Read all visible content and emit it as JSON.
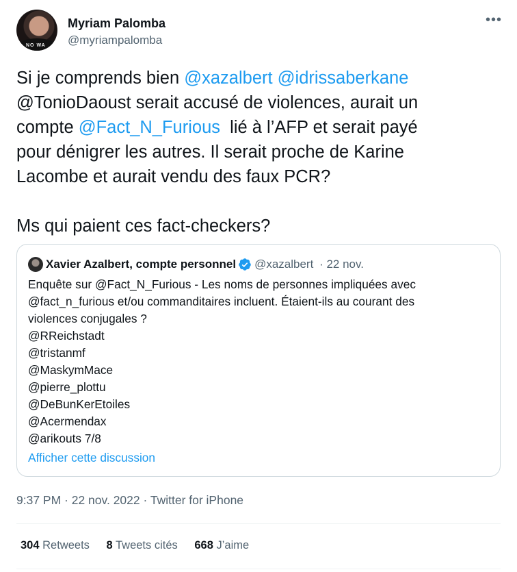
{
  "author": {
    "name": "Myriam Palomba",
    "handle": "@myriampalomba",
    "avatar_icon": "profile-photo-avatar",
    "avatar_text": "NO WA"
  },
  "menu_icon": "more-horizontal-icon",
  "tweet": {
    "line1_prefix": "Si je comprends bien ",
    "mention1": "@xazalbert",
    "mention2": "@idrissaberkane",
    "line2": "@TonioDaoust serait accusé de violences, aurait un",
    "line3_prefix": "compte ",
    "mention3": "@Fact_N_Furious",
    "line3_suffix": "  lié à l’AFP et serait payé",
    "line4": "pour dénigrer les autres. Il serait proche de Karine",
    "line5": "Lacombe et aurait vendu des faux PCR?",
    "line6": "Ms qui paient ces fact-checkers?"
  },
  "quote": {
    "name": "Xavier Azalbert, compte personnel",
    "verified_icon": "verified-badge-icon",
    "handle": "@xazalbert",
    "date": "· 22 nov.",
    "lines": [
      "Enquête sur @Fact_N_Furious - Les noms de personnes impliquées avec",
      "@fact_n_furious et/ou commanditaires incluent. Étaient-ils au courant des",
      "violences conjugales ?",
      "@RReichstadt",
      "@tristanmf",
      "@MaskymMace",
      "@pierre_plottu",
      "@DeBunKerEtoiles",
      "@Acermendax",
      "@arikouts 7/8"
    ],
    "show_thread": "Afficher cette discussion"
  },
  "timestamp": "9:37 PM · 22 nov. 2022 · Twitter for iPhone",
  "stats": {
    "retweets_count": "304",
    "retweets_label": "Retweets",
    "quotes_count": "8",
    "quotes_label": "Tweets cités",
    "likes_count": "668",
    "likes_label": "J’aime"
  },
  "colors": {
    "link": "#1d9bf0",
    "muted": "#536471",
    "border": "#cfd9de"
  }
}
